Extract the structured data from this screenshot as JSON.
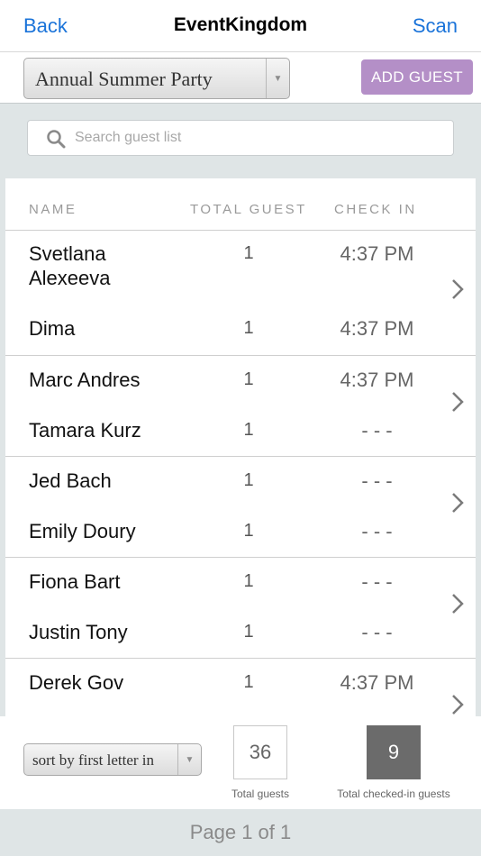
{
  "nav": {
    "back_label": "Back",
    "title": "EventKingdom",
    "scan_label": "Scan"
  },
  "event": {
    "selected": "Annual Summer Party",
    "add_guest_label": "ADD GUEST"
  },
  "search": {
    "placeholder": "Search guest list",
    "value": ""
  },
  "table": {
    "headers": {
      "name": "NAME",
      "total": "TOTAL GUEST",
      "checkin": "CHECK IN"
    },
    "groups": [
      {
        "rows": [
          {
            "name": "Svetlana Alexeeva",
            "total": "1",
            "checkin": "4:37 PM"
          },
          {
            "name": "Dima",
            "total": "1",
            "checkin": "4:37 PM"
          }
        ]
      },
      {
        "rows": [
          {
            "name": "Marc Andres",
            "total": "1",
            "checkin": "4:37 PM"
          },
          {
            "name": "Tamara Kurz",
            "total": "1",
            "checkin": "- - -"
          }
        ]
      },
      {
        "rows": [
          {
            "name": "Jed Bach",
            "total": "1",
            "checkin": "- - -"
          },
          {
            "name": "Emily Doury",
            "total": "1",
            "checkin": "- - -"
          }
        ]
      },
      {
        "rows": [
          {
            "name": "Fiona Bart",
            "total": "1",
            "checkin": "- - -"
          },
          {
            "name": "Justin Tony",
            "total": "1",
            "checkin": "- - -"
          }
        ]
      },
      {
        "rows": [
          {
            "name": "Derek Gov",
            "total": "1",
            "checkin": "4:37 PM"
          }
        ]
      }
    ]
  },
  "footer": {
    "sort_selected": "sort by first letter in",
    "total_guests": "36",
    "total_guests_label": "Total guests",
    "checked_in": "9",
    "checked_in_label": "Total checked-in guests"
  },
  "pager": {
    "label": "Page 1 of 1"
  },
  "colors": {
    "accent_blue": "#1a73d9",
    "add_guest": "#b48fc7",
    "checked_box": "#6b6b6b"
  }
}
